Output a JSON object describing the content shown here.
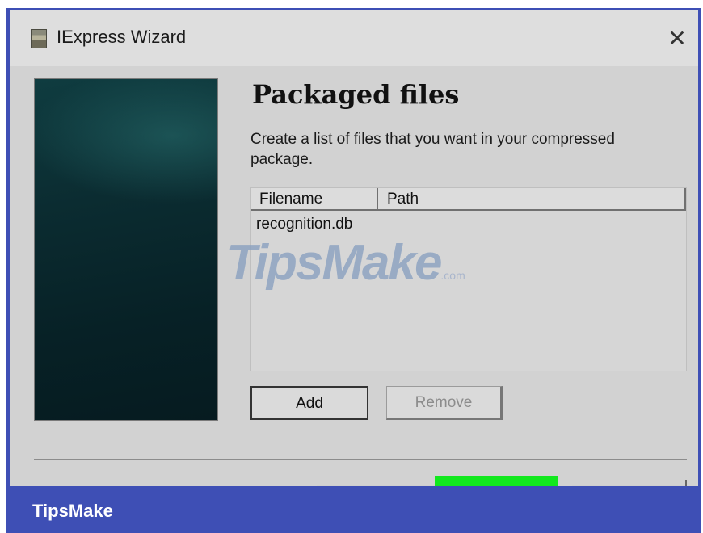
{
  "window": {
    "title": "IExpress Wizard",
    "close_glyph": "✕"
  },
  "page": {
    "title": "Packaged files",
    "description": "Create a list of files that you want in your compressed package."
  },
  "file_list": {
    "columns": [
      "Filename",
      "Path"
    ],
    "rows": [
      {
        "filename": "recognition.db",
        "path": ""
      }
    ]
  },
  "buttons": {
    "add": "Add",
    "remove": "Remove"
  },
  "watermark": {
    "text": "TipsMake",
    "suffix": ".com"
  },
  "banner": {
    "text": "TipsMake"
  },
  "colors": {
    "frame": "#3e4fb5",
    "highlight": "#12e81e"
  },
  "icons": {
    "app": "installer-package-icon",
    "close": "close-icon"
  }
}
